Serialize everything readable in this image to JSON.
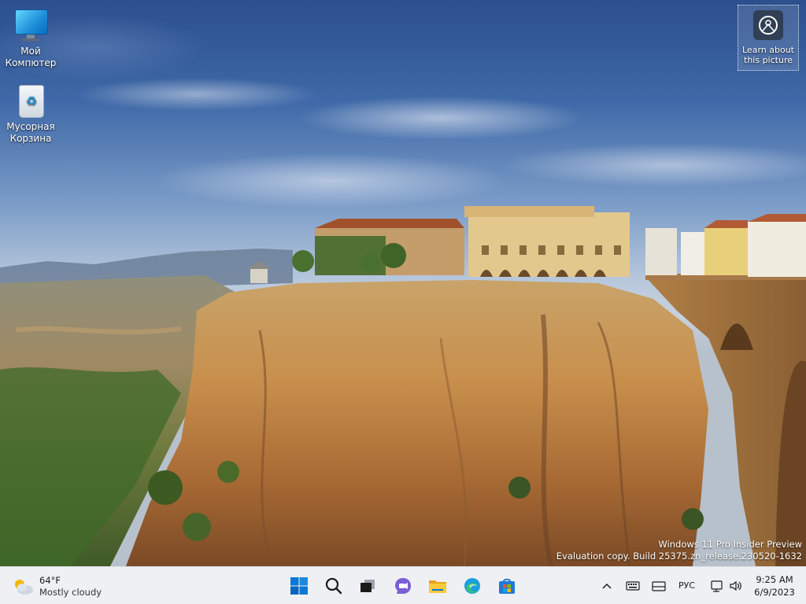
{
  "desktop": {
    "icons": [
      {
        "label_line1": "Мой",
        "label_line2": "Компютер",
        "icon": "monitor-icon"
      },
      {
        "label_line1": "Мусорная",
        "label_line2": "Корзина",
        "icon": "recycle-bin-icon"
      }
    ],
    "learn_picture": {
      "line1": "Learn about",
      "line2": "this picture",
      "icon": "camera-icon"
    },
    "watermark": {
      "line1": "Windows 11 Pro Insider Preview",
      "line2": "Evaluation copy. Build 25375.zn_release.230520-1632"
    }
  },
  "taskbar": {
    "weather": {
      "temp": "64°F",
      "condition": "Mostly cloudy",
      "icon": "partly-cloudy-icon"
    },
    "apps": [
      {
        "name": "start-button",
        "icon": "windows-logo-icon"
      },
      {
        "name": "search-button",
        "icon": "search-icon"
      },
      {
        "name": "task-view-button",
        "icon": "task-view-icon"
      },
      {
        "name": "chat-button",
        "icon": "chat-icon"
      },
      {
        "name": "file-explorer-button",
        "icon": "folder-icon"
      },
      {
        "name": "edge-button",
        "icon": "edge-icon"
      },
      {
        "name": "store-button",
        "icon": "store-icon"
      }
    ],
    "tray": {
      "overflow_icon": "chevron-up-icon",
      "keyboard_icon": "keyboard-icon",
      "tablet_icon": "touch-keyboard-icon",
      "language": "РУС",
      "network_icon": "network-icon",
      "volume_icon": "speaker-icon"
    },
    "clock": {
      "time": "9:25 AM",
      "date": "6/9/2023"
    }
  },
  "colors": {
    "taskbar_bg": "#eef0f4",
    "windows_blue": "#0078d4",
    "text_white": "#ffffff"
  }
}
